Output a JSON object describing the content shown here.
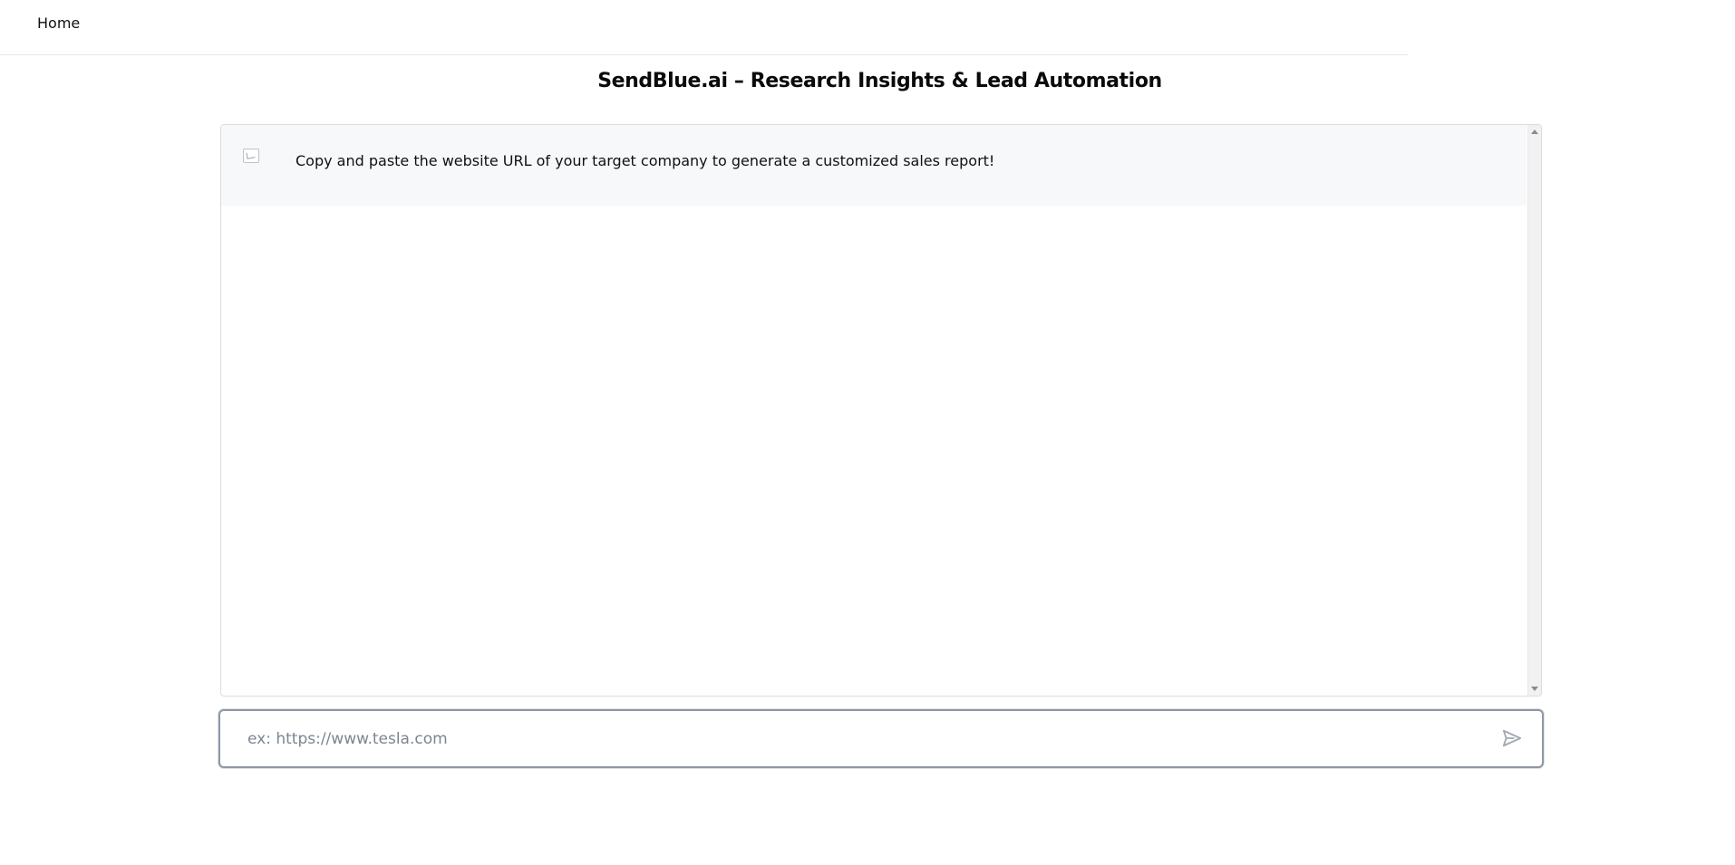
{
  "nav": {
    "home_label": "Home"
  },
  "page": {
    "title": "SendBlue.ai – Research Insights & Lead Automation"
  },
  "chat": {
    "messages": [
      {
        "avatar_icon": "broken-image-icon",
        "text": "Copy and paste the website URL of your target company to generate a customized sales report!"
      }
    ]
  },
  "input": {
    "placeholder": "ex: https://www.tesla.com",
    "value": ""
  },
  "send_button": {
    "icon": "send-icon"
  },
  "colors": {
    "message_background": "#f7f8fa",
    "input_border": "#8f97a3",
    "send_icon": "#a3a8af"
  }
}
